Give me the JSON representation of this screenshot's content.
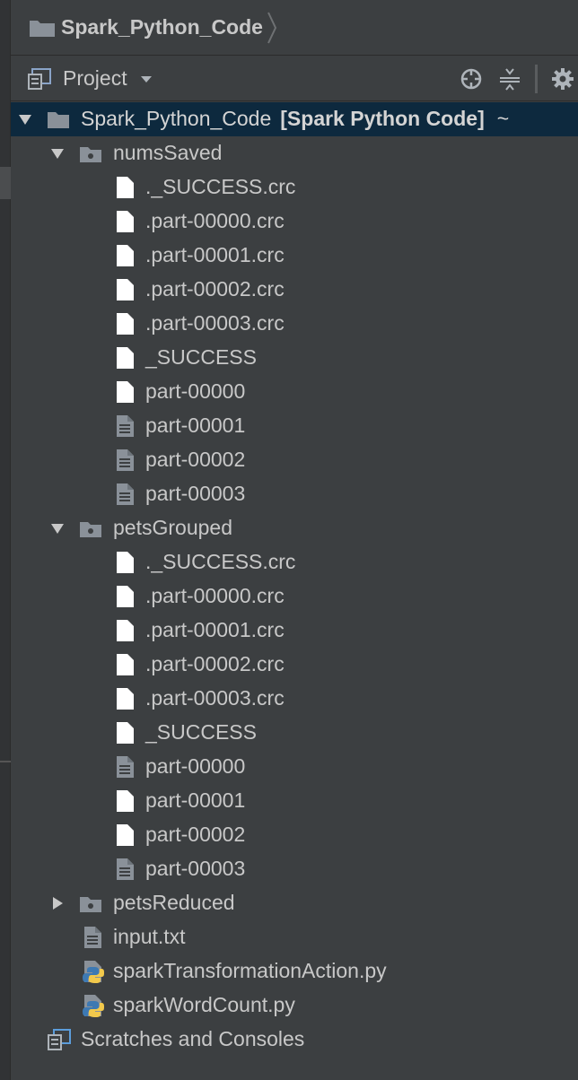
{
  "breadcrumb": {
    "project_name": "Spark_Python_Code"
  },
  "toolbar": {
    "view_label": "Project"
  },
  "tree": {
    "root": {
      "name": "Spark_Python_Code",
      "module": "[Spark Python Code]",
      "suffix": "~"
    },
    "numsSaved": {
      "name": "numsSaved",
      "files": [
        "._SUCCESS.crc",
        ".part-00000.crc",
        ".part-00001.crc",
        ".part-00002.crc",
        ".part-00003.crc",
        "_SUCCESS",
        "part-00000",
        "part-00001",
        "part-00002",
        "part-00003"
      ]
    },
    "petsGrouped": {
      "name": "petsGrouped",
      "files": [
        "._SUCCESS.crc",
        ".part-00000.crc",
        ".part-00001.crc",
        ".part-00002.crc",
        ".part-00003.crc",
        "_SUCCESS",
        "part-00000",
        "part-00001",
        "part-00002",
        "part-00003"
      ]
    },
    "petsReduced": {
      "name": "petsReduced"
    },
    "root_files": [
      "input.txt",
      "sparkTransformationAction.py",
      "sparkWordCount.py"
    ],
    "scratches": "Scratches and Consoles"
  },
  "colors": {
    "background": "#3c3f41",
    "selection": "#0d293e",
    "text": "#c8c8c8",
    "folder_icon": "#8a9199",
    "file_icon": "#ffffff"
  }
}
